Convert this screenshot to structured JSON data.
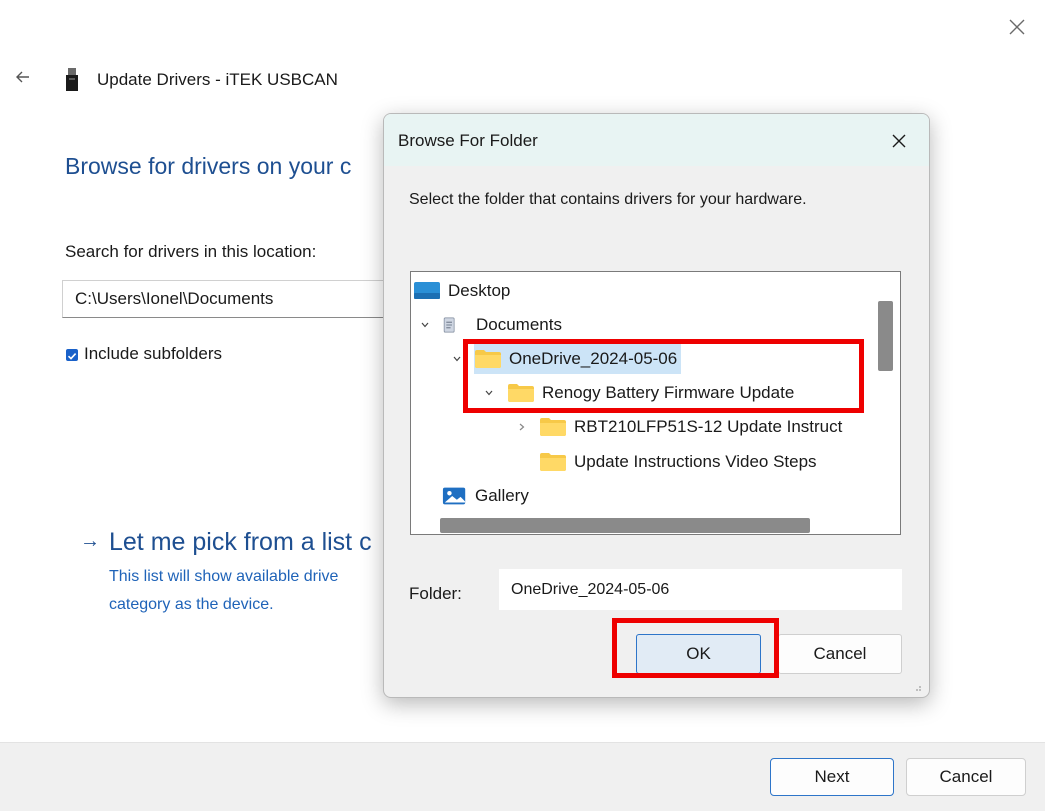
{
  "wizard": {
    "title": "Update Drivers - iTEK USBCAN",
    "heading": "Browse for drivers on your c",
    "search_label": "Search for drivers in this location:",
    "path_value": "C:\\Users\\Ionel\\Documents",
    "include_subfolders_label": "Include subfolders",
    "include_subfolders_checked": true,
    "pick_arrow": "→",
    "pick_title": "Let me pick from a list c",
    "pick_desc_line1": "This list will show available drive",
    "pick_desc_line2": "category as the device.",
    "next_label": "Next",
    "cancel_label": "Cancel"
  },
  "dialog": {
    "title": "Browse For Folder",
    "instruction": "Select the folder that contains drivers for your hardware.",
    "tree": [
      {
        "label": "Desktop",
        "icon": "desktop-icon",
        "expanded": null
      },
      {
        "label": "Documents",
        "icon": "documents-icon",
        "expanded": true
      },
      {
        "label": "OneDrive_2024-05-06",
        "icon": "folder-icon",
        "expanded": true,
        "selected": true
      },
      {
        "label": "Renogy Battery Firmware Update",
        "icon": "folder-icon",
        "expanded": true
      },
      {
        "label": "RBT210LFP51S-12 Update Instruct",
        "icon": "folder-icon",
        "expanded": false
      },
      {
        "label": "Update Instructions Video Steps",
        "icon": "folder-icon",
        "expanded": null
      },
      {
        "label": "Gallery",
        "icon": "gallery-icon",
        "expanded": null
      }
    ],
    "folder_label": "Folder:",
    "folder_value": "OneDrive_2024-05-06",
    "ok_label": "OK",
    "cancel_label": "Cancel"
  },
  "colors": {
    "accent_blue": "#1e4f91",
    "link_blue": "#1f63b8",
    "highlight_red": "#ee0000",
    "folder_yellow": "#f7c948",
    "selection": "#cce4f7"
  }
}
